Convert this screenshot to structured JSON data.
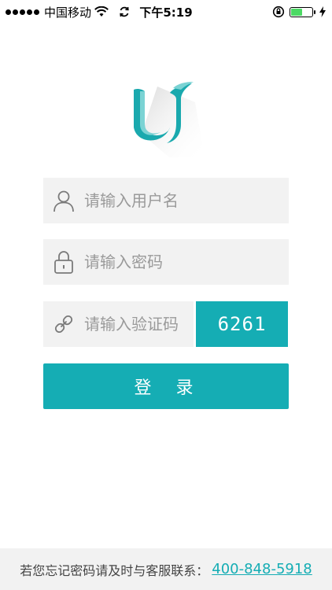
{
  "status_bar": {
    "carrier": "中国移动",
    "time": "下午5:19",
    "battery_level": 0.6
  },
  "form": {
    "username_placeholder": "请输入用户名",
    "password_placeholder": "请输入密码",
    "captcha_placeholder": "请输入验证码",
    "captcha_code": "6261",
    "login_label": "登 录"
  },
  "footer": {
    "text": "若您忘记密码请及时与客服联系：",
    "phone": "400-848-5918"
  },
  "colors": {
    "accent": "#15adb4",
    "field_bg": "#f2f2f2",
    "placeholder": "#9a9a9a"
  }
}
